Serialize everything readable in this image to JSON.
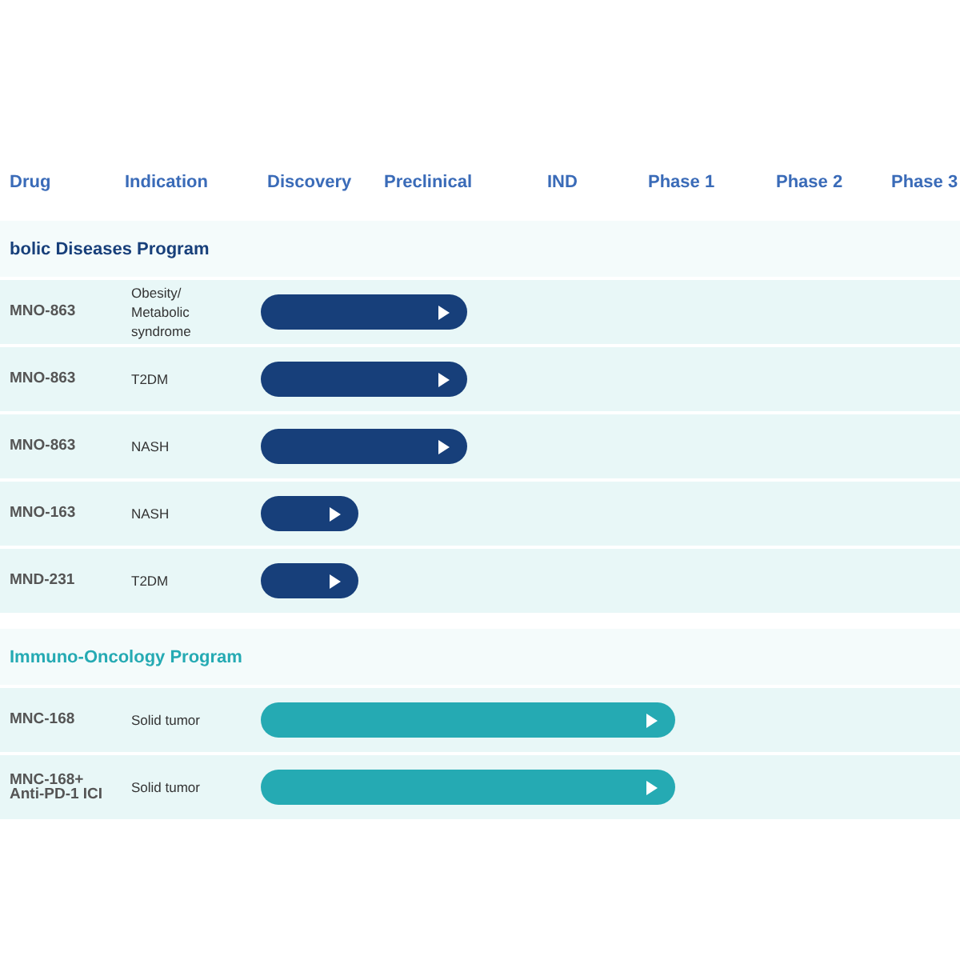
{
  "columns": [
    "Drug",
    "Indication",
    "Discovery",
    "Preclinical",
    "IND",
    "Phase 1",
    "Phase 2",
    "Phase 3"
  ],
  "programs": [
    {
      "title": "bolic Diseases Program",
      "color": "#173f7a",
      "rows": [
        {
          "drug": "MNO-863",
          "indication": "Obesity/ Metabolic syndrome",
          "kind": "preclinical"
        },
        {
          "drug": "MNO-863",
          "indication": "T2DM",
          "kind": "preclinical"
        },
        {
          "drug": "MNO-863",
          "indication": "NASH",
          "kind": "preclinical"
        },
        {
          "drug": "MNO-163",
          "indication": "NASH",
          "kind": "discovery"
        },
        {
          "drug": "MND-231",
          "indication": "T2DM",
          "kind": "discovery"
        }
      ]
    },
    {
      "title": "Immuno-Oncology Program",
      "color": "#25aab3",
      "rows": [
        {
          "drug": "MNC-168",
          "indication": "Solid tumor",
          "kind": "phase1"
        },
        {
          "drug": "MNC-168+ Anti-PD-1 ICI",
          "indication": "Solid tumor",
          "kind": "phase1"
        }
      ]
    }
  ]
}
